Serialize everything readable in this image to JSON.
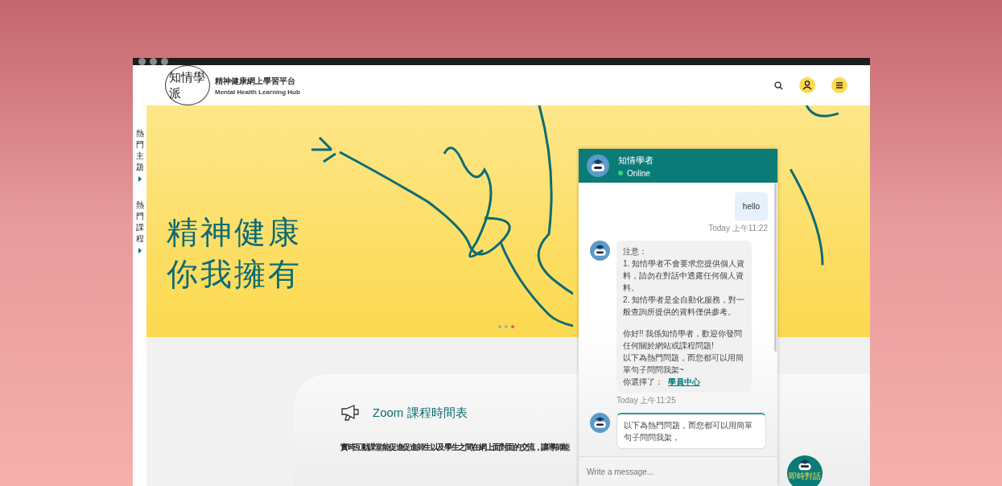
{
  "logo": {
    "mark": "知情學派",
    "title": "精神健康網上學習平台",
    "subtitle": "Mental Health Learning Hub"
  },
  "side_tabs": [
    {
      "label": "熱門主題"
    },
    {
      "label": "熱門課程"
    }
  ],
  "hero": {
    "lines": [
      "精神健康",
      "你我擁有"
    ],
    "dots": [
      {
        "selected": false
      },
      {
        "selected": false
      },
      {
        "selected": true
      }
    ]
  },
  "section": {
    "title": "Zoom 課程時間表",
    "text": "實時互動課堂能促進促進師生以及學生之間在網上面對面的交流，讓導師能"
  },
  "chat": {
    "name": "知情學者",
    "status": "Online",
    "online": true,
    "messages": [
      {
        "kind": "user",
        "text": "hello",
        "time": "Today 上午11:22"
      },
      {
        "kind": "bot",
        "paragraphs": [
          "注意：\n1. 知情學者不會要求您提供個人資料，請勿在對話中透露任何個人資料。\n2. 知情學者是全自動化服務，對一般查詢所提供的資料僅供參考。",
          "你好!! 我係知情學者，歡迎你發問任何關於網站或課程問題!\n以下為熱門問題，而您都可以用簡單句子問問我架~\n你選擇了："
        ],
        "link": "學員中心",
        "time": "Today 上午11:25"
      },
      {
        "kind": "card",
        "paragraphs": [
          "以下為熱門問題，而您都可以用簡單句子問問我架，"
        ]
      }
    ],
    "placeholder": "Write a message...",
    "launcher": "即時對話"
  }
}
